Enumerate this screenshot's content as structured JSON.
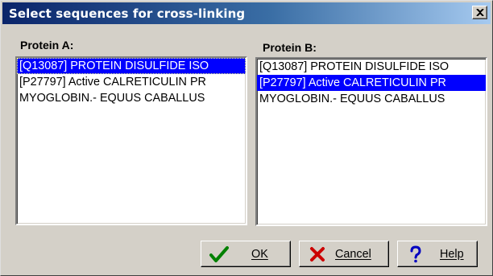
{
  "window": {
    "title": "Select sequences for cross-linking"
  },
  "protein_a": {
    "label": "Protein A:",
    "items": [
      {
        "text": "[Q13087] PROTEIN DISULFIDE ISO",
        "selected": true
      },
      {
        "text": "[P27797] Active CALRETICULIN PR",
        "selected": false
      },
      {
        "text": "MYOGLOBIN.-  EQUUS CABALLUS",
        "selected": false
      }
    ]
  },
  "protein_b": {
    "label": "Protein B:",
    "items": [
      {
        "text": "[Q13087] PROTEIN DISULFIDE ISO",
        "selected": false
      },
      {
        "text": "[P27797] Active CALRETICULIN PR",
        "selected": true
      },
      {
        "text": "MYOGLOBIN.-  EQUUS CABALLUS",
        "selected": false
      }
    ]
  },
  "buttons": {
    "ok": {
      "label": "OK",
      "icon": "checkmark-icon"
    },
    "cancel": {
      "label": "Cancel",
      "icon": "x-icon"
    },
    "help": {
      "label": "Help",
      "icon": "question-icon"
    }
  },
  "colors": {
    "title_gradient_start": "#0a246a",
    "title_gradient_end": "#a6caf0",
    "selection": "#0000ff",
    "ok_icon": "#008000",
    "cancel_icon": "#cc0000",
    "help_icon": "#0000c0"
  }
}
